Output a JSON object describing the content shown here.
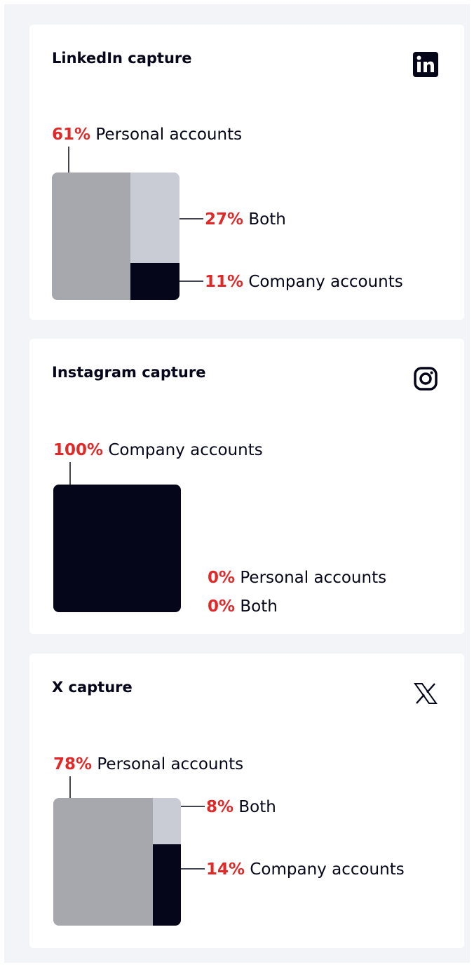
{
  "colors": {
    "personal": "#a7a8ae",
    "both": "#c9ccd4",
    "company": "#05061a",
    "percent": "#e02a2a"
  },
  "cards": [
    {
      "title": "LinkedIn capture",
      "icon": "linkedin-icon"
    },
    {
      "title": "Instagram capture",
      "icon": "instagram-icon"
    },
    {
      "title": "X capture",
      "icon": "x-icon"
    }
  ],
  "chart_data": [
    {
      "type": "bar",
      "title": "LinkedIn capture",
      "series": [
        {
          "name": "Personal accounts",
          "percent_label": "61%",
          "value": 61
        },
        {
          "name": "Both",
          "percent_label": "27%",
          "value": 27
        },
        {
          "name": "Company accounts",
          "percent_label": "11%",
          "value": 11
        }
      ]
    },
    {
      "type": "bar",
      "title": "Instagram capture",
      "series": [
        {
          "name": "Company accounts",
          "percent_label": "100%",
          "value": 100
        },
        {
          "name": "Personal accounts",
          "percent_label": "0%",
          "value": 0
        },
        {
          "name": "Both",
          "percent_label": "0%",
          "value": 0
        }
      ]
    },
    {
      "type": "bar",
      "title": "X capture",
      "series": [
        {
          "name": "Personal accounts",
          "percent_label": "78%",
          "value": 78
        },
        {
          "name": "Both",
          "percent_label": "8%",
          "value": 8
        },
        {
          "name": "Company accounts",
          "percent_label": "14%",
          "value": 14
        }
      ]
    }
  ]
}
